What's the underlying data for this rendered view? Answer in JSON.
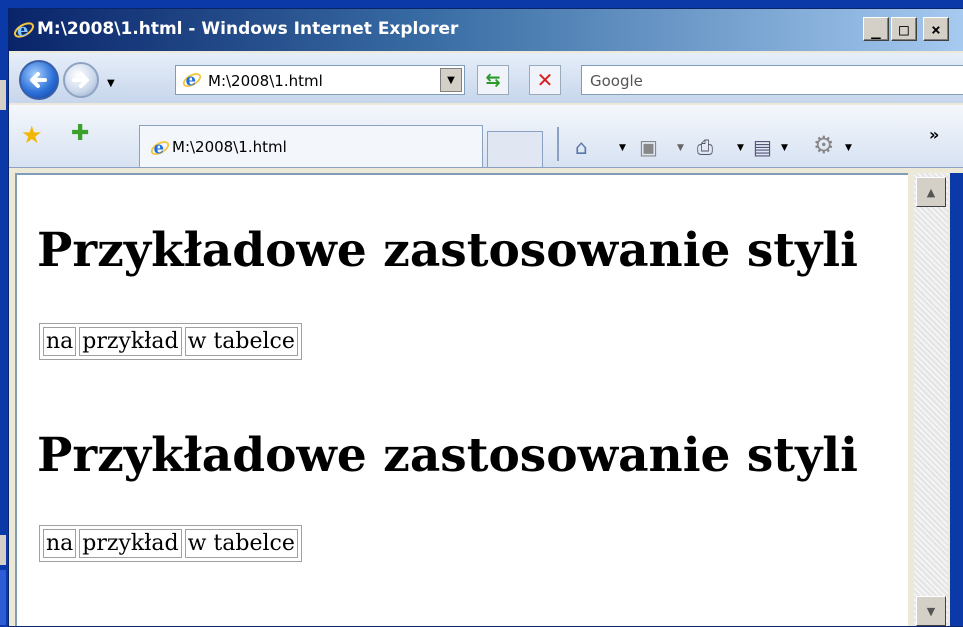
{
  "window": {
    "title": "M:\\2008\\1.html - Windows Internet Explorer",
    "controls": {
      "minimize": "_",
      "maximize": "□",
      "close": "×"
    }
  },
  "navbar": {
    "address": "M:\\2008\\1.html",
    "search_placeholder": "Google"
  },
  "tabs": [
    {
      "label": "M:\\2008\\1.html"
    }
  ],
  "content": {
    "sections": [
      {
        "heading": "Przykładowe zastosowanie styli",
        "cells": [
          "na",
          "przykład",
          "w tabelce"
        ]
      },
      {
        "heading": "Przykładowe zastosowanie styli",
        "cells": [
          "na",
          "przykład",
          "w tabelce"
        ]
      }
    ]
  },
  "icons": [
    "ie-icon",
    "back-arrow-icon",
    "forward-arrow-icon",
    "refresh-icon",
    "stop-icon",
    "favorites-star-icon",
    "add-favorites-icon",
    "home-icon",
    "feeds-icon",
    "print-icon",
    "page-icon",
    "tools-gear-icon",
    "chevron-double-right-icon"
  ],
  "colors": {
    "titlebar_start": "#0a246a",
    "titlebar_end": "#a6caf0",
    "desktop": "#0b3aa8"
  }
}
